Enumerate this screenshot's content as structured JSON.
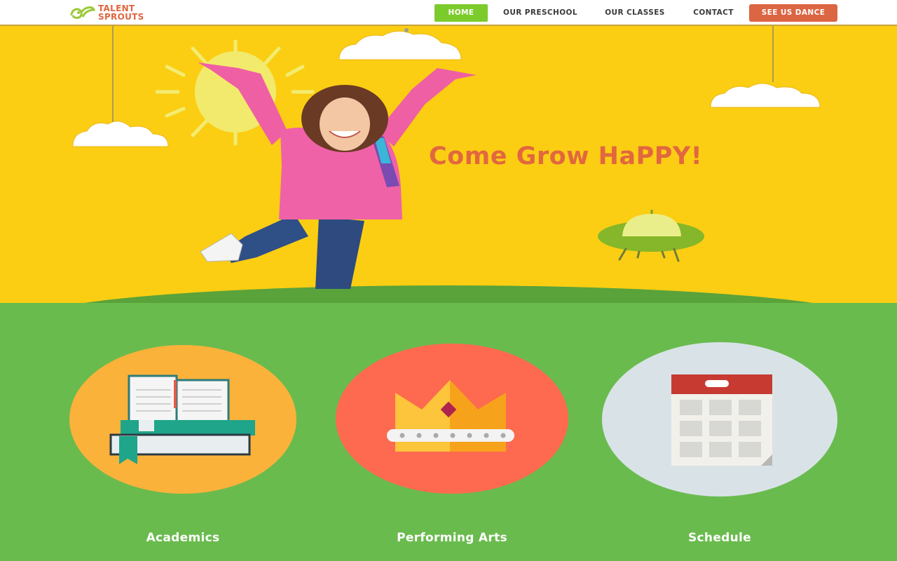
{
  "brand": {
    "line1": "TALENT",
    "line2": "SPROUTS",
    "logo_icon": "sprout-logo-icon",
    "color": "#e0653f"
  },
  "nav": {
    "home": "HOME",
    "preschool": "OUR PRESCHOOL",
    "classes": "OUR CLASSES",
    "contact": "CONTACT",
    "cta": "SEE US DANCE",
    "active_color": "#7ccb2d",
    "cta_color": "#dc6543"
  },
  "hero": {
    "tagline": "Come Grow HaPPY!",
    "background": "#fbce13",
    "tagline_color": "#e2673f"
  },
  "features": [
    {
      "label": "Academics",
      "icon": "books-icon",
      "color": "#fbb23a"
    },
    {
      "label": "Performing Arts",
      "icon": "crown-icon",
      "color": "#fd6a4f"
    },
    {
      "label": "Schedule",
      "icon": "calendar-icon",
      "color": "#d9e3e7"
    }
  ],
  "section_background": "#6abb4e"
}
